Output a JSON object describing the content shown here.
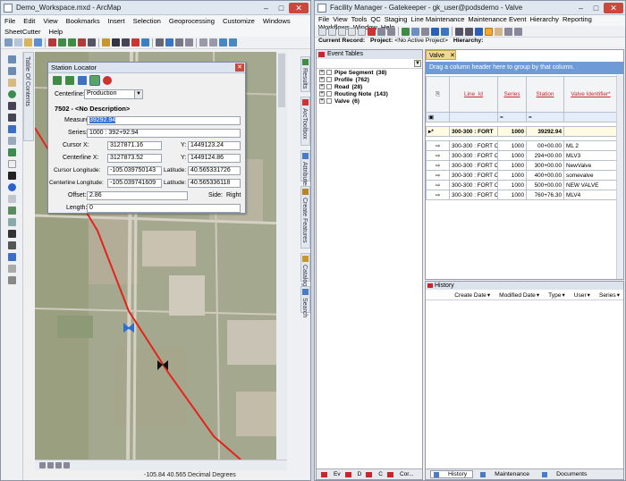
{
  "arcmap": {
    "title": "Demo_Workspace.mxd - ArcMap",
    "menu": [
      "File",
      "Edit",
      "View",
      "Bookmarks",
      "Insert",
      "Selection",
      "Geoprocessing",
      "Customize",
      "Windows",
      "SheetCutter",
      "Help"
    ],
    "toc_label": "Table Of Contents",
    "right_tabs": [
      "Results",
      "ArcToolbox",
      "Attributes",
      "Create Features",
      "Catalog",
      "Search"
    ],
    "status_coords": "-105.84  40.565 Decimal Degrees",
    "station_locator": {
      "title": "Station Locator",
      "centerline_label": "Centerline:",
      "centerline_value": "Production",
      "header": "7502 - <No Description>",
      "measure_label": "Measure:",
      "measure_value": "39292.94",
      "series_label": "Series:",
      "series_value": "1000 : 392+92.94",
      "cursor_x_label": "Cursor X:",
      "cursor_x_value": "3127871.16",
      "cursor_y_label": "Y:",
      "cursor_y_value": "1449123.24",
      "cl_x_label": "Centerline X:",
      "cl_x_value": "3127873.52",
      "cl_y_label": "Y:",
      "cl_y_value": "1449124.86",
      "cursor_lon_label": "Cursor Longitude:",
      "cursor_lon_value": "-105.039750143",
      "cursor_lat_label": "Latitude:",
      "cursor_lat_value": "40.565331726",
      "cl_lon_label": "Centerline Longitude:",
      "cl_lon_value": "-105.039741609",
      "cl_lat_label": "Latitude:",
      "cl_lat_value": "40.565336118",
      "offset_label": "Offset:",
      "offset_value": "2.86",
      "side_label": "Side:",
      "side_value": "Right",
      "length_label": "Length:",
      "length_value": "0"
    }
  },
  "facility_manager": {
    "title": "Facility Manager - Gatekeeper - gk_user@podsdemo - Valve",
    "menu": [
      "File",
      "View",
      "Tools",
      "QC",
      "Staging",
      "Line Maintenance",
      "Maintenance Event",
      "Hierarchy",
      "Reporting",
      "Workflows",
      "Window",
      "Help"
    ],
    "current_record_label": "Current Record:",
    "project_label": "Project:",
    "project_value": "<No Active Project>",
    "hierarchy_label": "Hierarchy:",
    "event_tables_title": "Event Tables",
    "event_tables": [
      {
        "name": "Pipe Segment",
        "count": "(38)"
      },
      {
        "name": "Profile",
        "count": "(762)"
      },
      {
        "name": "Road",
        "count": "(28)"
      },
      {
        "name": "Routing Note",
        "count": "(143)"
      },
      {
        "name": "Valve",
        "count": "(6)"
      }
    ],
    "event_bottom_tabs": [
      "Ev",
      "D",
      "C",
      "Cor..."
    ],
    "valve_tab": "Valve",
    "group_hint": "Drag a column header here to group by that column.",
    "columns": [
      "Line_Id",
      "Series",
      "Station",
      "Valve Identifier*"
    ],
    "filter_row": [
      "",
      "=",
      "=",
      ""
    ],
    "current_row": [
      "300-300 : FORT",
      "1000",
      "39292.94",
      ""
    ],
    "rows": [
      [
        "300-300 : FORT C",
        "1000",
        "00+00.00",
        "ML 2"
      ],
      [
        "300-300 : FORT C",
        "1000",
        "294+00.00",
        "MLV3"
      ],
      [
        "300-300 : FORT C",
        "1000",
        "300+00.00",
        "NewValve"
      ],
      [
        "300-300 : FORT C",
        "1000",
        "400+00.00",
        "somevalve"
      ],
      [
        "300-300 : FORT C",
        "1000",
        "500+00.00",
        "NEW VALVE"
      ],
      [
        "300-300 : FORT C",
        "1000",
        "760+76.30",
        "MLV4"
      ]
    ],
    "history_title": "History",
    "history_columns": [
      "Create Date",
      "Modified Date",
      "Type",
      "User",
      "Series"
    ],
    "history_tabs": [
      "History",
      "Maintenance",
      "Documents"
    ]
  }
}
